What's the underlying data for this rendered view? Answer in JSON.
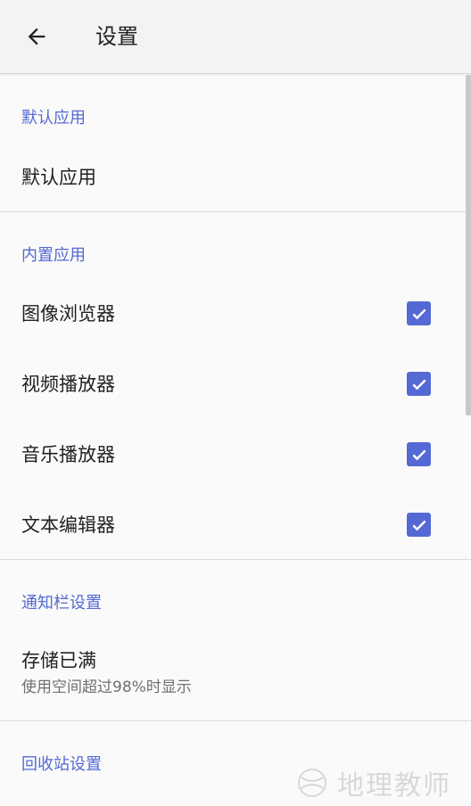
{
  "appbar": {
    "title": "设置",
    "back_icon": "arrow-left-icon"
  },
  "sections": {
    "default_apps": {
      "header": "默认应用",
      "items": [
        {
          "label": "默认应用"
        }
      ]
    },
    "builtin_apps": {
      "header": "内置应用",
      "items": [
        {
          "label": "图像浏览器",
          "checked": true
        },
        {
          "label": "视频播放器",
          "checked": true
        },
        {
          "label": "音乐播放器",
          "checked": true
        },
        {
          "label": "文本编辑器",
          "checked": true
        }
      ]
    },
    "notification": {
      "header": "通知栏设置",
      "items": [
        {
          "label": "存储已满",
          "summary": "使用空间超过98%时显示"
        }
      ]
    },
    "recycle_bin": {
      "header": "回收站设置"
    }
  },
  "colors": {
    "accent": "#5469d4",
    "background": "#fafafa",
    "appbar": "#f3f3f3"
  },
  "watermark": {
    "text": "地理教师"
  }
}
